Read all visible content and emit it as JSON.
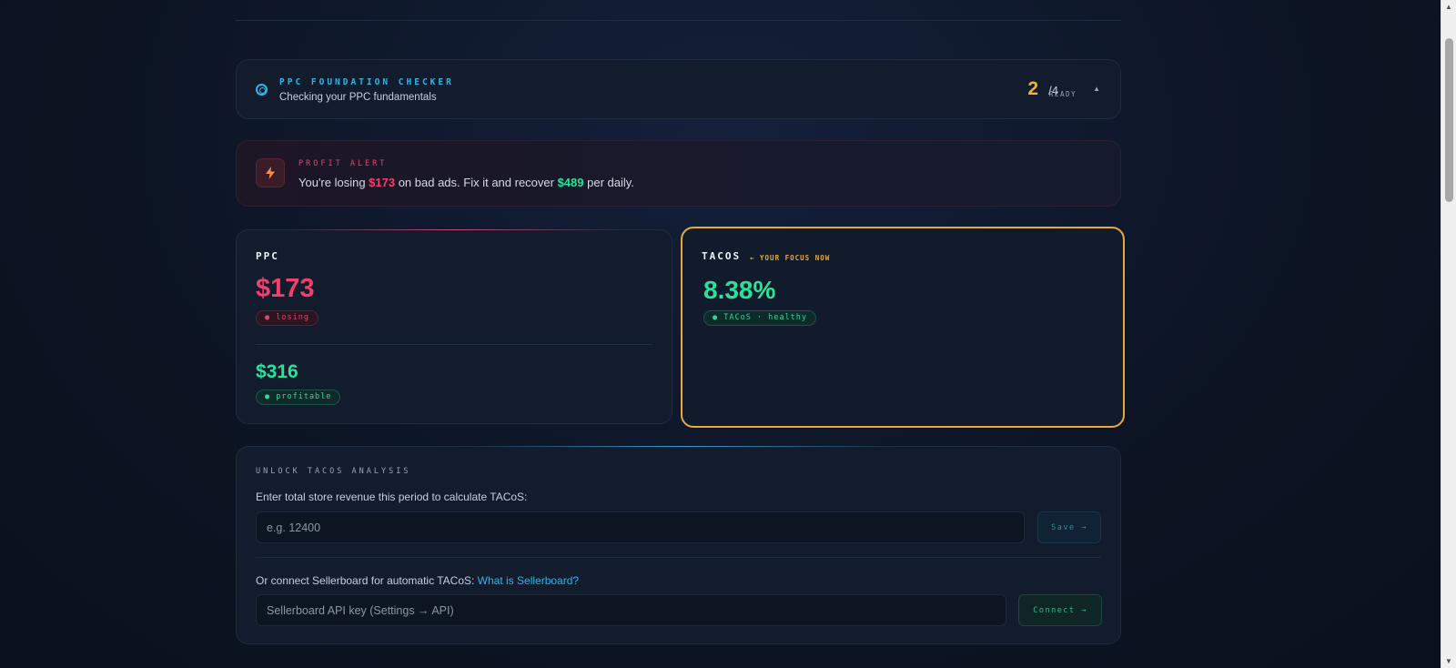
{
  "checker": {
    "title": "PPC FOUNDATION CHECKER",
    "subtitle": "Checking your PPC fundamentals",
    "ready_count": "2",
    "ready_total": "/4",
    "ready_label": "READY",
    "caret": "▲"
  },
  "alert": {
    "label": "PROFIT ALERT",
    "icon": "bolt-icon",
    "msg_prefix": "You're losing ",
    "loss": "$173",
    "msg_mid": " on bad ads. Fix it and recover ",
    "gain": "$489",
    "msg_suffix": " per daily."
  },
  "ppc": {
    "title": "PPC",
    "losing_value": "$173",
    "losing_badge": "● losing",
    "profitable_value": "$316",
    "profitable_badge": "● profitable"
  },
  "tacos": {
    "title": "TACOS",
    "focus": "← YOUR FOCUS NOW",
    "percent": "8.38%",
    "badge": "● TACoS · healthy"
  },
  "unlock": {
    "label": "UNLOCK TACOS ANALYSIS",
    "revenue_desc": "Enter total store revenue this period to calculate TACoS:",
    "revenue_placeholder": "e.g. 12400",
    "save_label": "Save →",
    "sellerboard_desc": "Or connect Sellerboard for automatic TACoS: ",
    "sellerboard_link": "What is Sellerboard?",
    "api_placeholder": "Sellerboard API key (Settings → API)",
    "connect_label": "Connect →"
  },
  "colors": {
    "accent_cyan": "#2ab7e8",
    "loss_red": "#f2406c",
    "gain_green": "#27e39a",
    "focus_gold": "#e8a93a"
  }
}
